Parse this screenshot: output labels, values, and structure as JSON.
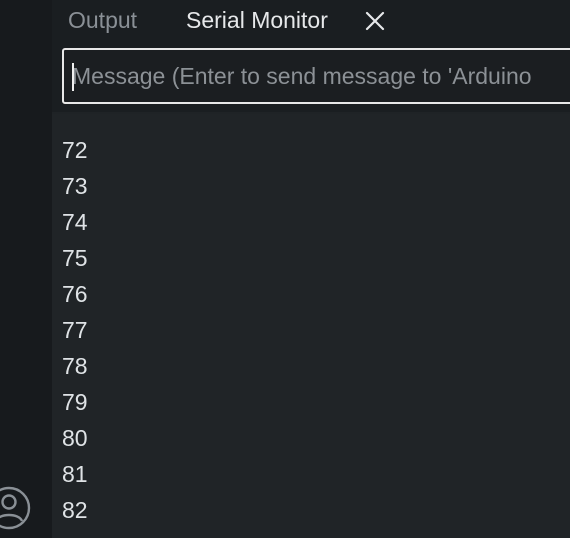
{
  "tabs": {
    "output_label": "Output",
    "serial_label": "Serial Monitor"
  },
  "message": {
    "placeholder": "Message (Enter to send message to 'Arduino"
  },
  "serial_output": [
    "72",
    "73",
    "74",
    "75",
    "76",
    "77",
    "78",
    "79",
    "80",
    "81",
    "82"
  ],
  "icons": {
    "close": "close-icon",
    "account": "account-icon"
  },
  "colors": {
    "panel_background": "#1f2326",
    "header_background": "#1a1e21",
    "active_tab_text": "#e6e8ea",
    "inactive_tab_text": "#8a9096",
    "input_border": "#e8e8e8"
  }
}
